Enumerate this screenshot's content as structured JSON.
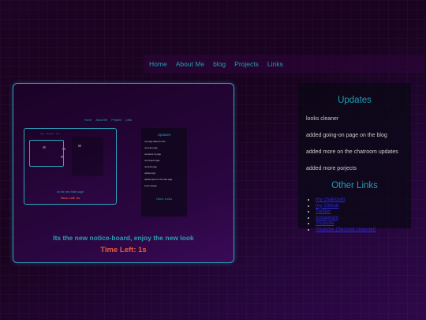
{
  "nav": {
    "links": [
      "Home",
      "About Me",
      "blog",
      "Projects",
      "Links"
    ]
  },
  "board": {
    "message": "Its the new notice-board, enjoy the new look",
    "timer": "Time Left: 1s",
    "preview": {
      "nav": [
        "Home",
        "About Me",
        "Projects",
        "Links"
      ],
      "message": "Its the new finite page",
      "timer": "Time Left: 2s",
      "sidebar_title": "Updates",
      "sidebar_items": [
        "new page added on links",
        "new index page",
        "new about me page",
        "new projects page",
        "new links page",
        "updated style",
        "updated layout on the index page",
        "Index redesign"
      ],
      "other_links_title": "Other Links"
    }
  },
  "sidebar": {
    "updates_title": "Updates",
    "updates": [
      "looks cleaner",
      "added going-on page on the blog",
      "added more on the chatroom updates",
      "added more porjects"
    ],
    "other_links_title": "Other Links",
    "other_links": [
      "my chatroom",
      "my Github",
      "Twitter",
      "Instagram",
      "Youtube",
      "Youtube (Second channel)"
    ]
  },
  "colors": {
    "accent": "#1e9fb4",
    "timer": "#ef5a38",
    "link": "#2d2bd9"
  }
}
